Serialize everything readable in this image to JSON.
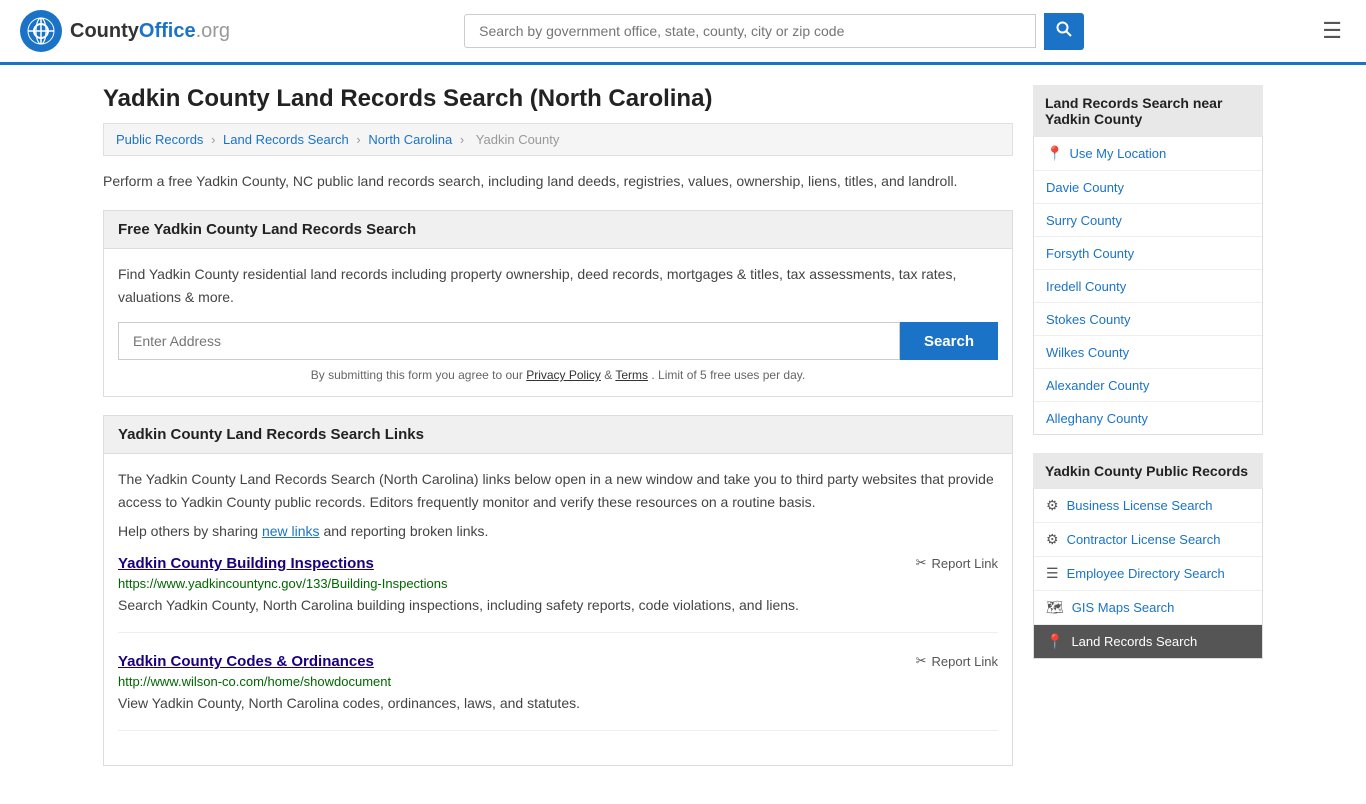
{
  "header": {
    "logo_text": "CountyOffice",
    "logo_org": ".org",
    "search_placeholder": "Search by government office, state, county, city or zip code"
  },
  "breadcrumb": {
    "items": [
      "Public Records",
      "Land Records Search",
      "North Carolina",
      "Yadkin County"
    ]
  },
  "page": {
    "title": "Yadkin County Land Records Search (North Carolina)",
    "description": "Perform a free Yadkin County, NC public land records search, including land deeds, registries, values, ownership, liens, titles, and landroll."
  },
  "free_search_section": {
    "header": "Free Yadkin County Land Records Search",
    "body": "Find Yadkin County residential land records including property ownership, deed records, mortgages & titles, tax assessments, tax rates, valuations & more.",
    "input_placeholder": "Enter Address",
    "search_button": "Search",
    "form_notice": "By submitting this form you agree to our",
    "privacy_label": "Privacy Policy",
    "and_label": "&",
    "terms_label": "Terms",
    "limit_notice": ". Limit of 5 free uses per day."
  },
  "links_section": {
    "header": "Yadkin County Land Records Search Links",
    "intro": "The Yadkin County Land Records Search (North Carolina) links below open in a new window and take you to third party websites that provide access to Yadkin County public records. Editors frequently monitor and verify these resources on a routine basis.",
    "share_text": "Help others by sharing",
    "new_links_label": "new links",
    "share_end": "and reporting broken links.",
    "links": [
      {
        "title": "Yadkin County Building Inspections",
        "url": "https://www.yadkincountync.gov/133/Building-Inspections",
        "description": "Search Yadkin County, North Carolina building inspections, including safety reports, code violations, and liens.",
        "report_label": "Report Link"
      },
      {
        "title": "Yadkin County Codes & Ordinances",
        "url": "http://www.wilson-co.com/home/showdocument",
        "description": "View Yadkin County, North Carolina codes, ordinances, laws, and statutes.",
        "report_label": "Report Link"
      }
    ]
  },
  "sidebar": {
    "nearby_section": {
      "header": "Land Records Search near Yadkin County",
      "use_my_location": "Use My Location",
      "counties": [
        "Davie County",
        "Surry County",
        "Forsyth County",
        "Iredell County",
        "Stokes County",
        "Wilkes County",
        "Alexander County",
        "Alleghany County"
      ]
    },
    "public_records_section": {
      "header": "Yadkin County Public Records",
      "items": [
        {
          "label": "Business License Search",
          "icon": "⚙"
        },
        {
          "label": "Contractor License Search",
          "icon": "⚙"
        },
        {
          "label": "Employee Directory Search",
          "icon": "☰"
        },
        {
          "label": "GIS Maps Search",
          "icon": "🗺"
        },
        {
          "label": "Land Records Search",
          "icon": "📍",
          "active": true
        }
      ]
    }
  }
}
